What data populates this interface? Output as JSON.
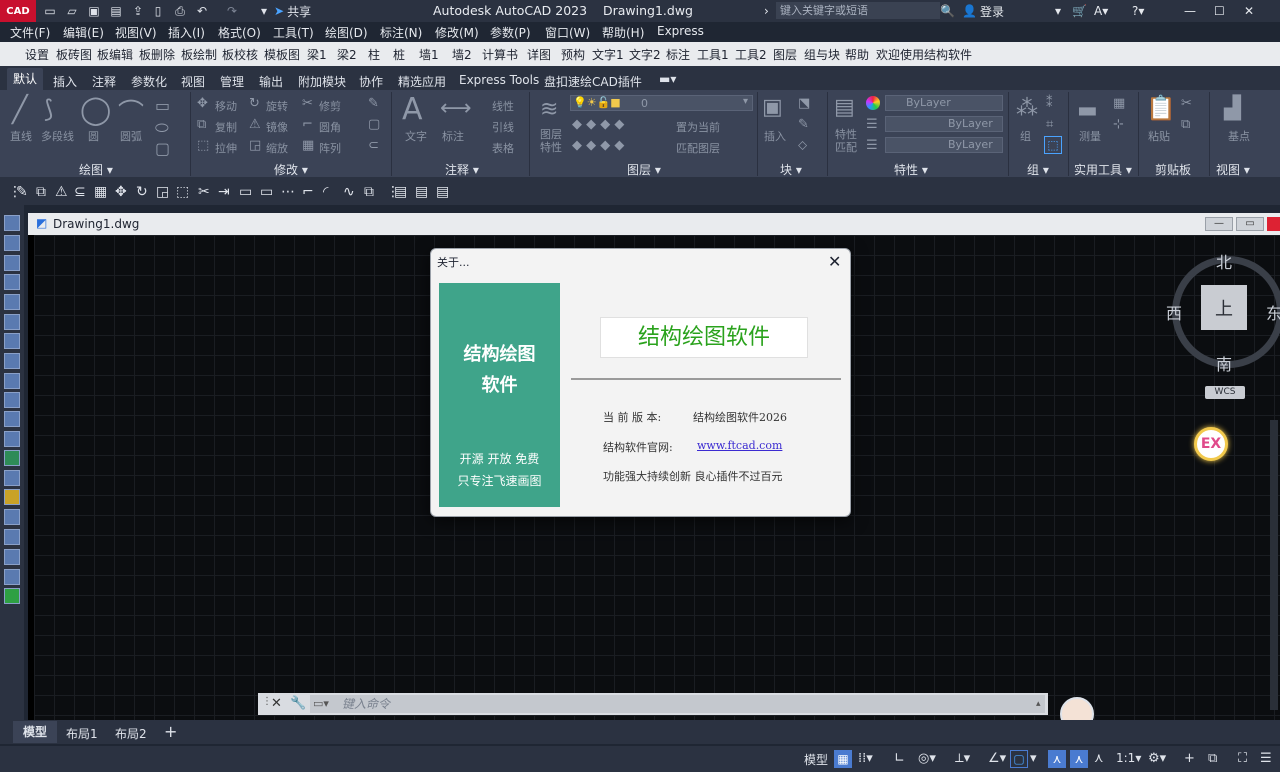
{
  "window": {
    "app_badge": "CAD",
    "title": "Autodesk AutoCAD 2023    Drawing1.dwg",
    "share_label": "共享",
    "search_placeholder": "键入关键字或短语",
    "login_label": "登录"
  },
  "menu1": [
    "文件(F)",
    "编辑(E)",
    "视图(V)",
    "插入(I)",
    "格式(O)",
    "工具(T)",
    "绘图(D)",
    "标注(N)",
    "修改(M)",
    "参数(P)",
    "窗口(W)",
    "帮助(H)",
    "Express"
  ],
  "menu2": [
    "设置",
    "板砖图",
    "板编辑",
    "板删除",
    "板绘制",
    "板校核",
    "模板图",
    "梁1",
    "梁2",
    "柱",
    "桩",
    "墙1",
    "墙2",
    "计算书",
    "详图",
    "预构",
    "文字1",
    "文字2",
    "标注",
    "工具1",
    "工具2",
    "图层",
    "组与块",
    "帮助",
    "欢迎使用结构软件"
  ],
  "ribbon_tabs": [
    "默认",
    "插入",
    "注释",
    "参数化",
    "视图",
    "管理",
    "输出",
    "附加模块",
    "协作",
    "精选应用",
    "Express Tools",
    "盘扣速绘CAD插件"
  ],
  "ribbon": {
    "draw_tools": [
      "直线",
      "多段线",
      "圆",
      "圆弧"
    ],
    "modify_tools": [
      "移动",
      "旋转",
      "修剪",
      "复制",
      "镜像",
      "圆角",
      "拉伸",
      "缩放",
      "阵列"
    ],
    "annotation_tools": [
      "文字",
      "标注",
      "线性",
      "引线",
      "表格"
    ],
    "layer_tools": [
      "图层特性",
      "置为当前",
      "匹配图层"
    ],
    "layer_value": "0",
    "block_tools": [
      "插入"
    ],
    "property_tools": [
      "特性匹配"
    ],
    "bylayer": "ByLayer",
    "group_tools": [
      "组"
    ],
    "utility_tools": [
      "测量"
    ],
    "clipboard_tools": [
      "粘贴"
    ],
    "view_tools": [
      "基点"
    ],
    "panels": [
      "绘图",
      "修改",
      "注释",
      "图层",
      "块",
      "特性",
      "组",
      "实用工具",
      "剪贴板",
      "视图"
    ]
  },
  "document": {
    "title": "Drawing1.dwg"
  },
  "viewcube": {
    "north": "北",
    "south": "南",
    "west": "西",
    "east": "东",
    "top": "上",
    "wcs": "WCS"
  },
  "ex_badge": "EX",
  "command": {
    "placeholder": "键入命令"
  },
  "layout_tabs": [
    "模型",
    "布局1",
    "布局2"
  ],
  "status": {
    "model": "模型",
    "scale": "1:1"
  },
  "dialog": {
    "title": "关于...",
    "side_title_line1": "结构绘图",
    "side_title_line2": "软件",
    "side_tag1": "开源 开放  免费",
    "side_tag2": "只专注飞速画图",
    "brand": "结构绘图软件",
    "version_label": "当 前 版 本:",
    "version_value": "结构绘图软件2026",
    "site_label": "结构软件官网:",
    "site_value": "www.ftcad.com",
    "slogan": "功能强大持续创新  良心插件不过百元"
  }
}
